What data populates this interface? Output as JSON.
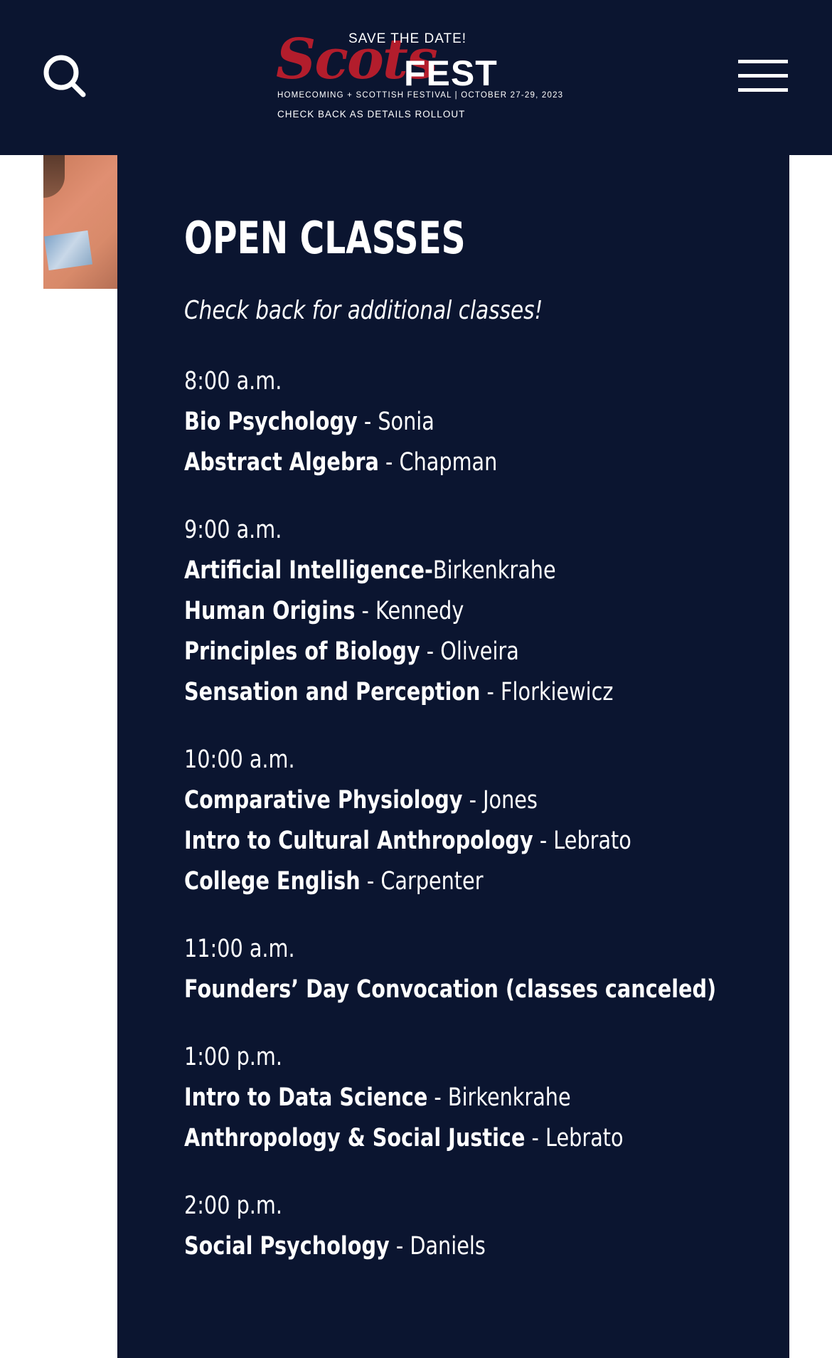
{
  "header": {
    "logo": {
      "save_the_date": "SAVE THE DATE!",
      "scots": "Scots",
      "fest": "FEST",
      "tagline": "HOMECOMING + SCOTTISH FESTIVAL | OCTOBER 27-29, 2023",
      "check_back": "CHECK BACK AS DETAILS ROLLOUT"
    },
    "icons": {
      "search": "search-icon",
      "menu": "hamburger-menu-icon"
    }
  },
  "colors": {
    "navy": "#0b1530",
    "logo_red": "#b31d2c",
    "white": "#ffffff"
  },
  "main": {
    "title": "OPEN CLASSES",
    "subtitle": "Check back for additional classes!",
    "slots": [
      {
        "time": "8:00 a.m.",
        "classes": [
          {
            "name": "Bio Psychology",
            "sep": " - ",
            "instructor": "Sonia"
          },
          {
            "name": "Abstract Algebra",
            "sep": " - ",
            "instructor": "Chapman"
          }
        ]
      },
      {
        "time": "9:00 a.m.",
        "classes": [
          {
            "name": "Artificial Intelligence-",
            "sep": "",
            "instructor": "Birkenkrahe"
          },
          {
            "name": "Human Origins",
            "sep": " - ",
            "instructor": "Kennedy"
          },
          {
            "name": "Principles of Biology",
            "sep": " - ",
            "instructor": "Oliveira"
          },
          {
            "name": "Sensation and Perception",
            "sep": " - ",
            "instructor": "Florkiewicz"
          }
        ]
      },
      {
        "time": "10:00 a.m.",
        "classes": [
          {
            "name": "Comparative Physiology",
            "sep": " - ",
            "instructor": "Jones"
          },
          {
            "name": "Intro to Cultural Anthropology",
            "sep": " - ",
            "instructor": "Lebrato"
          },
          {
            "name": "College English",
            "sep": " - ",
            "instructor": "Carpenter"
          }
        ]
      },
      {
        "time": "11:00 a.m.",
        "classes": [
          {
            "name": "Founders’ Day Convocation (classes canceled)",
            "sep": "",
            "instructor": ""
          }
        ]
      },
      {
        "time": "1:00 p.m.",
        "classes": [
          {
            "name": "Intro to Data Science",
            "sep": " - ",
            "instructor": "Birkenkrahe"
          },
          {
            "name": "Anthropology & Social Justice",
            "sep": " - ",
            "instructor": "Lebrato"
          }
        ]
      },
      {
        "time": "2:00 p.m.",
        "classes": [
          {
            "name": "Social Psychology",
            "sep": " - ",
            "instructor": "Daniels"
          }
        ]
      }
    ]
  }
}
